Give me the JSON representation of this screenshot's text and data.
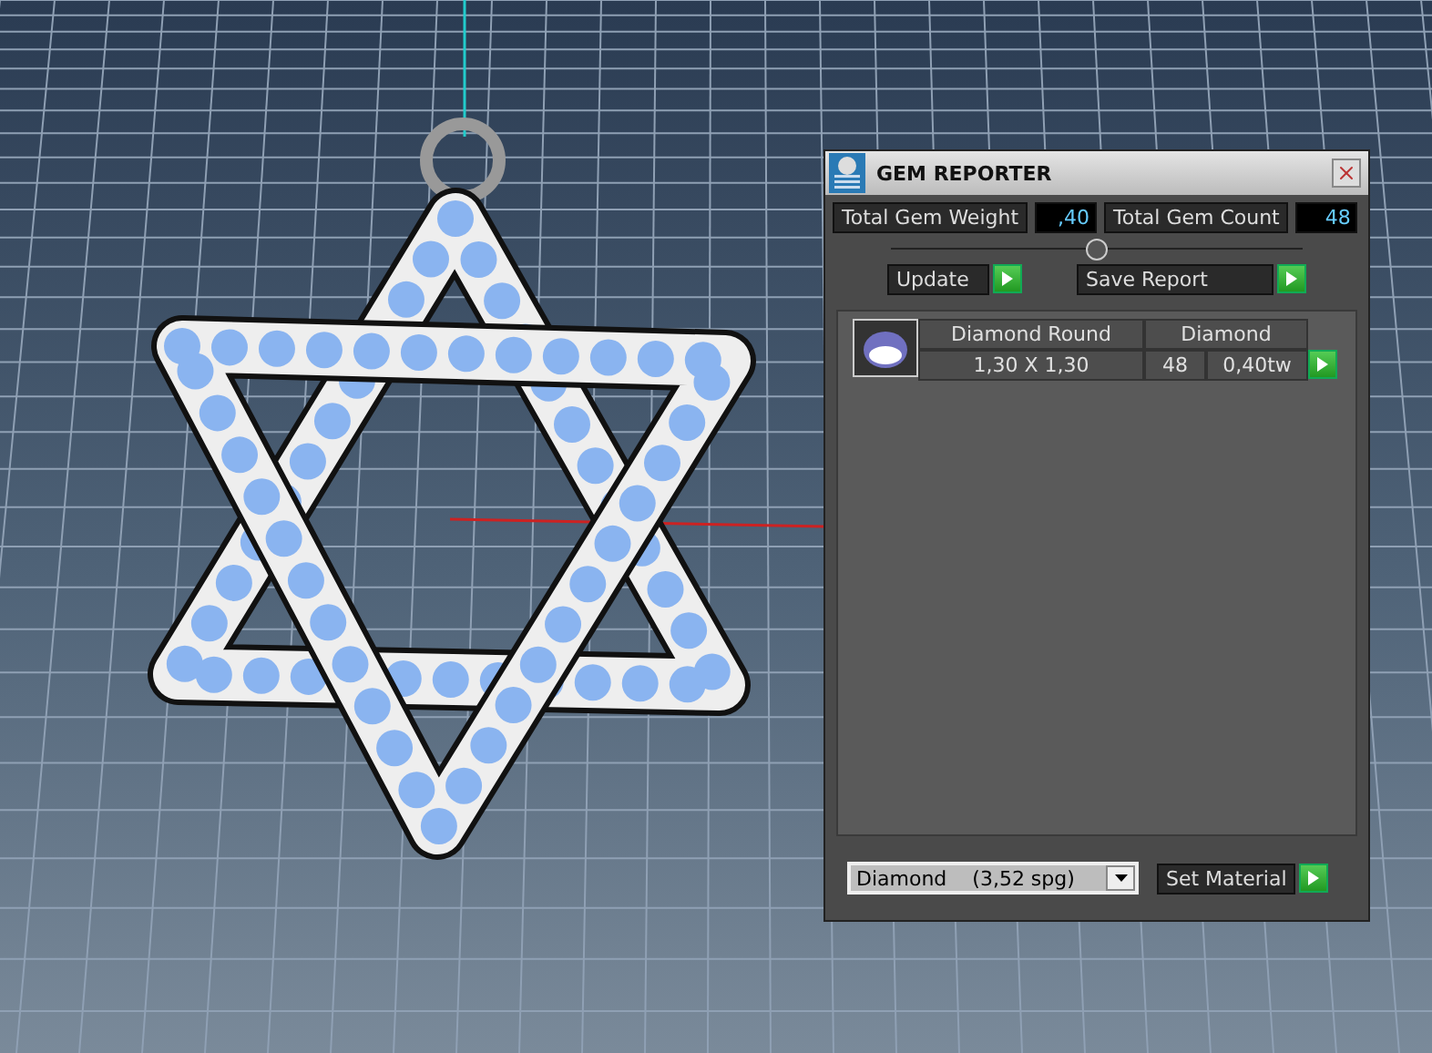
{
  "panel": {
    "title": "GEM REPORTER",
    "totals": [
      {
        "label": "Total Gem Weight",
        "value": ",40"
      },
      {
        "label": "Total Gem Count",
        "value": "48"
      }
    ],
    "actions": [
      {
        "label": "Update"
      },
      {
        "label": "Save Report"
      }
    ],
    "gems": [
      {
        "shape": "Diamond Round",
        "material": "Diamond",
        "size": "1,30 X 1,30",
        "count": "48",
        "weight": "0,40tw"
      }
    ],
    "material_select": {
      "value": "Diamond    (3,52 spg)"
    },
    "set_material": {
      "label": "Set Material"
    }
  }
}
